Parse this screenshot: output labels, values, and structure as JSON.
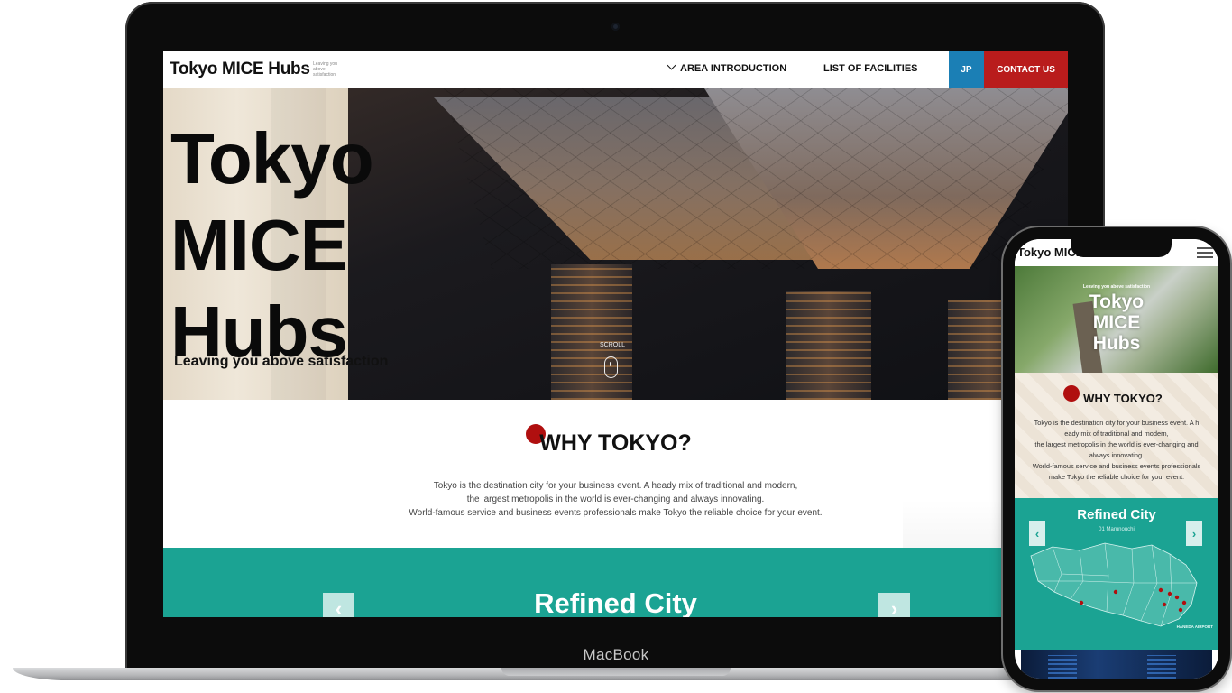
{
  "laptop": {
    "brand": "MacBook",
    "site": {
      "logo": "Tokyo MICE Hubs",
      "tagline": "Leaving you above satisfaction",
      "nav": {
        "area_intro": "AREA INTRODUCTION",
        "facilities": "LIST OF FACILITIES",
        "lang": "JP",
        "contact": "CONTACT US"
      },
      "hero": {
        "title_lines": [
          "Tokyo",
          "MICE",
          "Hubs"
        ],
        "subtitle": "Leaving you above satisfaction",
        "scroll_label": "SCROLL"
      },
      "why": {
        "title": "WHY TOKYO?",
        "lines": [
          "Tokyo is the destination city for your business event. A heady mix of traditional and modern,",
          "the largest metropolis in the world is ever-changing and always innovating.",
          "World-famous service and business events professionals make Tokyo the reliable choice for your event."
        ]
      },
      "refined": {
        "title": "Refined City",
        "prev": "‹",
        "next": "›"
      }
    }
  },
  "phone": {
    "logo": "Tokyo MICE Hubs",
    "hero": {
      "tagline": "Leaving you above satisfaction",
      "title_lines": [
        "Tokyo",
        "MICE",
        "Hubs"
      ]
    },
    "why": {
      "title": "WHY TOKYO?",
      "lines": [
        "Tokyo is the destination city for your business event. A h",
        "eady mix of traditional and modern,",
        "the largest metropolis in the world is ever-changing and",
        "always innovating.",
        "World-famous service and business events professionals",
        "make Tokyo the reliable choice for your event."
      ]
    },
    "refined": {
      "title": "Refined City",
      "subtitle": "01 Marunouchi",
      "prev": "‹",
      "next": "›",
      "airport_label": "HANEDA AIRPORT"
    }
  },
  "colors": {
    "teal": "#1ba393",
    "contact_red": "#b91c1c",
    "jp_blue": "#1b7fb5",
    "accent_dot": "#b00f0f"
  }
}
